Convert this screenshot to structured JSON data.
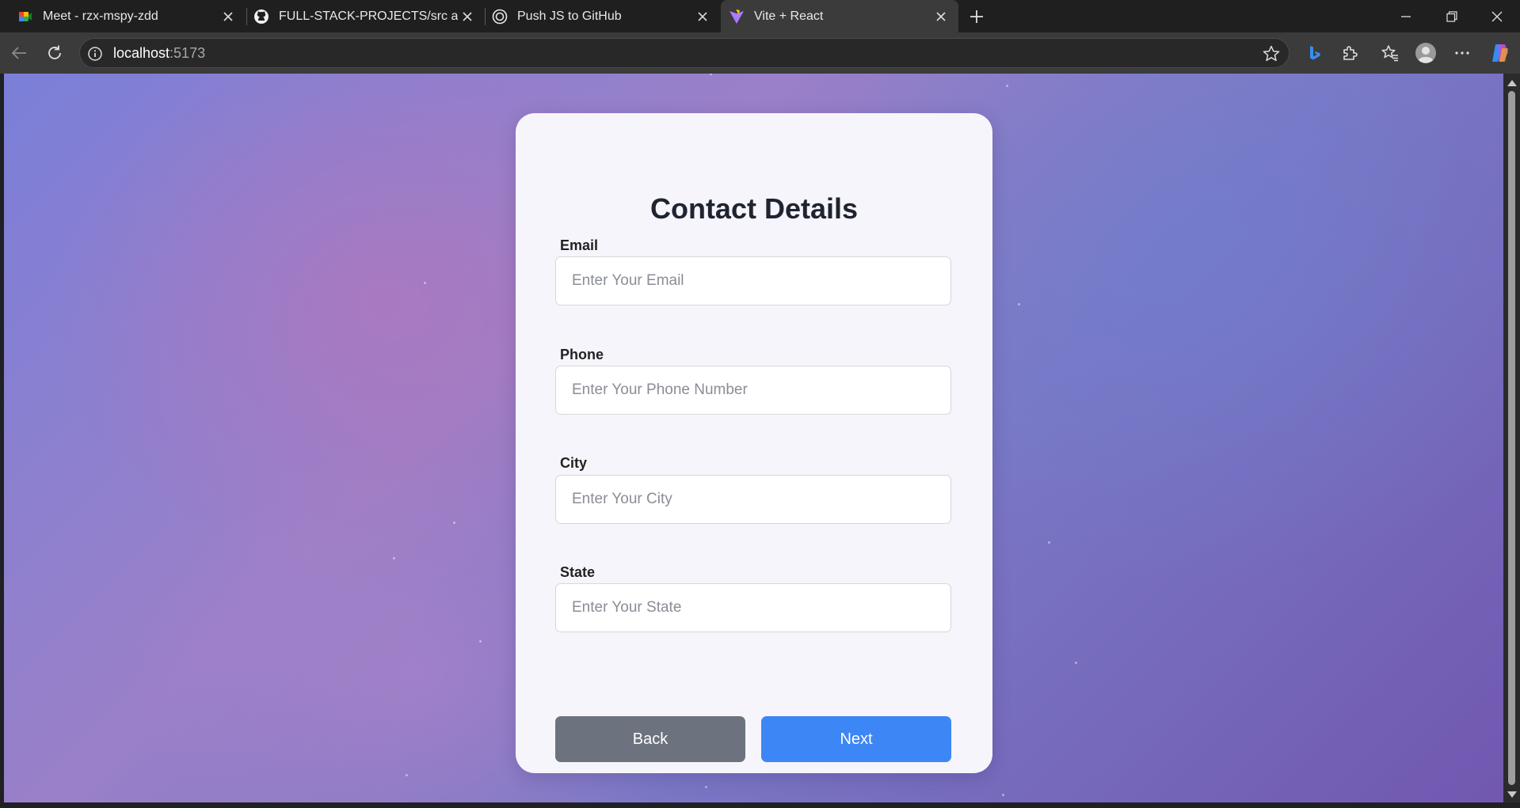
{
  "browser": {
    "tabs": [
      {
        "title": "Meet - rzx-mspy-zdd",
        "icon": "google-meet-icon",
        "active": false
      },
      {
        "title": "FULL-STACK-PROJECTS/src at main",
        "icon": "github-icon",
        "active": false
      },
      {
        "title": "Push JS to GitHub",
        "icon": "chatgpt-icon",
        "active": false
      },
      {
        "title": "Vite + React",
        "icon": "vite-icon",
        "active": true
      }
    ],
    "address": {
      "host": "localhost",
      "port": ":5173"
    }
  },
  "page": {
    "title": "Contact Details",
    "fields": [
      {
        "label": "Email",
        "placeholder": "Enter Your Email"
      },
      {
        "label": "Phone",
        "placeholder": "Enter Your Phone Number"
      },
      {
        "label": "City",
        "placeholder": "Enter Your City"
      },
      {
        "label": "State",
        "placeholder": "Enter Your State"
      }
    ],
    "buttons": {
      "back": "Back",
      "next": "Next"
    }
  },
  "colors": {
    "accent": "#3d86f6",
    "secondary_button": "#6c737e",
    "card_background": "#f6f5fb"
  }
}
